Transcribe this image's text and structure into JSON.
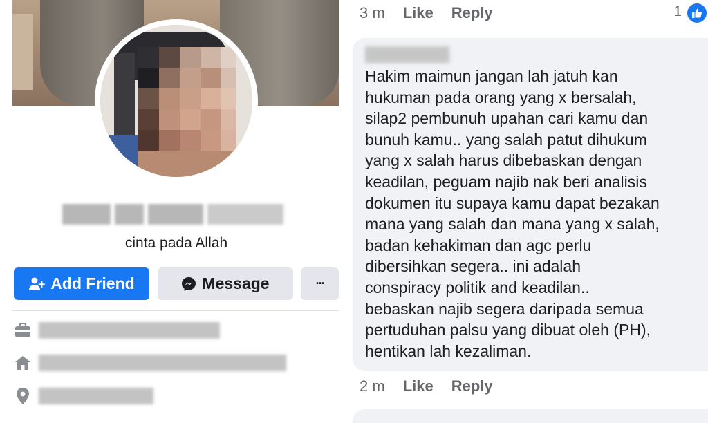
{
  "profile": {
    "bio": "cinta pada Allah",
    "buttons": {
      "add_friend": "Add Friend",
      "message": "Message",
      "more": "···"
    },
    "info_icons": [
      "briefcase-icon",
      "home-icon",
      "location-pin-icon"
    ]
  },
  "comment_top_meta": {
    "time": "3 m",
    "like": "Like",
    "reply": "Reply",
    "reaction_count": "1"
  },
  "comment": {
    "text": "Hakim maimun jangan lah jatuh kan\nhukuman pada orang yang x bersalah,\nsilap2 pembunuh upahan cari kamu dan\nbunuh kamu.. yang salah patut dihukum\nyang x salah harus dibebaskan dengan\nkeadilan, peguam najib nak beri analisis\ndokumen itu supaya kamu dapat bezakan\nmana yang salah dan mana yang x salah,\nbadan kehakiman dan agc perlu\ndibersihkan segera.. ini adalah\nconspiracy politik and keadilan..\nbebaskan najib segera daripada semua\npertuduhan palsu yang dibuat oleh (PH),\nhentikan lah kezaliman."
  },
  "comment_bottom_meta": {
    "time": "2 m",
    "like": "Like",
    "reply": "Reply"
  },
  "colors": {
    "primary": "#1877f2",
    "secondary_button": "#e4e6eb",
    "bubble": "#f0f2f5",
    "meta_text": "#65676b"
  }
}
